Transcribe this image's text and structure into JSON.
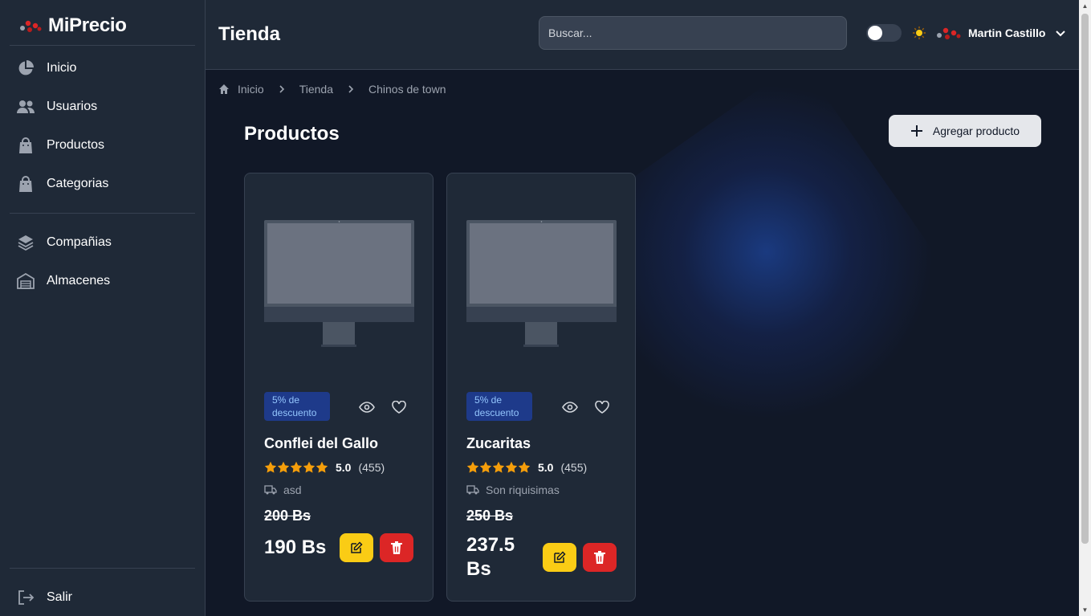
{
  "brand": {
    "name": "MiPrecio"
  },
  "sidebar": {
    "items": [
      {
        "label": "Inicio",
        "icon": "pie-chart-icon"
      },
      {
        "label": "Usuarios",
        "icon": "users-icon"
      },
      {
        "label": "Productos",
        "icon": "shopping-bag-icon"
      },
      {
        "label": "Categorias",
        "icon": "shopping-bag-icon"
      },
      {
        "label": "Compañias",
        "icon": "layers-icon"
      },
      {
        "label": "Almacenes",
        "icon": "warehouse-icon"
      }
    ],
    "logout_label": "Salir"
  },
  "header": {
    "title": "Tienda",
    "search_placeholder": "Buscar...",
    "user_name": "Martin Castillo",
    "dark_mode_on": false
  },
  "breadcrumb": [
    "Inicio",
    "Tienda",
    "Chinos de town"
  ],
  "main": {
    "section_title": "Productos",
    "add_button_label": "Agregar producto"
  },
  "products": [
    {
      "badge": "5% de descuento",
      "name": "Conflei del Gallo",
      "stars": 5,
      "rating": "5.0",
      "reviews": "(455)",
      "shipping": "asd",
      "old_price": "200 Bs",
      "price": "190 Bs"
    },
    {
      "badge": "5% de descuento",
      "name": "Zucaritas",
      "stars": 5,
      "rating": "5.0",
      "reviews": "(455)",
      "shipping": "Son riquisimas",
      "old_price": "250 Bs",
      "price": "237.5 Bs"
    }
  ],
  "colors": {
    "background": "#111827",
    "panel": "#1f2937",
    "accent_yellow": "#facc15",
    "accent_red": "#dc2626",
    "star": "#f59e0b",
    "badge_bg": "#1e3a8a",
    "badge_text": "#93c5fd"
  }
}
